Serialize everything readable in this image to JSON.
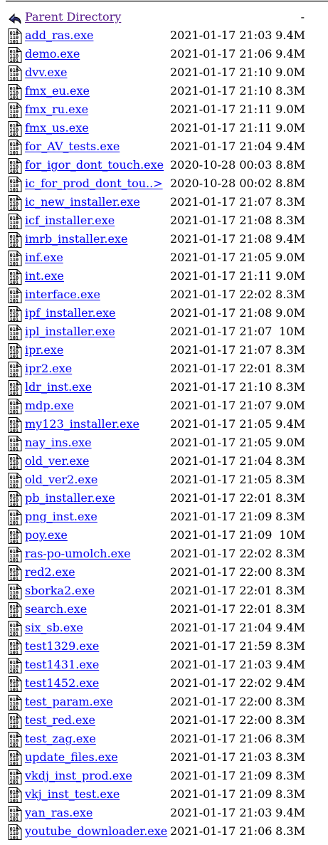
{
  "parent": {
    "label": "Parent Directory",
    "size": "-",
    "icon": "back-arrow-icon"
  },
  "file_icon": "binary-file-icon",
  "files": [
    {
      "name": "add_ras.exe",
      "date": "2021-01-17 21:03",
      "size": "9.4M"
    },
    {
      "name": "demo.exe",
      "date": "2021-01-17 21:06",
      "size": "9.4M"
    },
    {
      "name": "dvv.exe",
      "date": "2021-01-17 21:10",
      "size": "9.0M"
    },
    {
      "name": "fmx_eu.exe",
      "date": "2021-01-17 21:10",
      "size": "8.3M"
    },
    {
      "name": "fmx_ru.exe",
      "date": "2021-01-17 21:11",
      "size": "9.0M"
    },
    {
      "name": "fmx_us.exe",
      "date": "2021-01-17 21:11",
      "size": "9.0M"
    },
    {
      "name": "for_AV_tests.exe",
      "date": "2021-01-17 21:04",
      "size": "9.4M"
    },
    {
      "name": "for_igor_dont_touch.exe",
      "date": "2020-10-28 00:03",
      "size": "8.8M"
    },
    {
      "name": "ic_for_prod_dont_tou..>",
      "date": "2020-10-28 00:02",
      "size": "8.8M"
    },
    {
      "name": "ic_new_installer.exe",
      "date": "2021-01-17 21:07",
      "size": "8.3M"
    },
    {
      "name": "icf_installer.exe",
      "date": "2021-01-17 21:08",
      "size": "8.3M"
    },
    {
      "name": "imrb_installer.exe",
      "date": "2021-01-17 21:08",
      "size": "9.4M"
    },
    {
      "name": "inf.exe",
      "date": "2021-01-17 21:05",
      "size": "9.0M"
    },
    {
      "name": "int.exe",
      "date": "2021-01-17 21:11",
      "size": "9.0M"
    },
    {
      "name": "interface.exe",
      "date": "2021-01-17 22:02",
      "size": "8.3M"
    },
    {
      "name": "ipf_installer.exe",
      "date": "2021-01-17 21:08",
      "size": "9.0M"
    },
    {
      "name": "ipl_installer.exe",
      "date": "2021-01-17 21:07",
      "size": "10M"
    },
    {
      "name": "ipr.exe",
      "date": "2021-01-17 21:07",
      "size": "8.3M"
    },
    {
      "name": "ipr2.exe",
      "date": "2021-01-17 22:01",
      "size": "8.3M"
    },
    {
      "name": "ldr_inst.exe",
      "date": "2021-01-17 21:10",
      "size": "8.3M"
    },
    {
      "name": "mdp.exe",
      "date": "2021-01-17 21:07",
      "size": "9.0M"
    },
    {
      "name": "my123_installer.exe",
      "date": "2021-01-17 21:05",
      "size": "9.4M"
    },
    {
      "name": "nay_ins.exe",
      "date": "2021-01-17 21:05",
      "size": "9.0M"
    },
    {
      "name": "old_ver.exe",
      "date": "2021-01-17 21:04",
      "size": "8.3M"
    },
    {
      "name": "old_ver2.exe",
      "date": "2021-01-17 21:05",
      "size": "8.3M"
    },
    {
      "name": "pb_installer.exe",
      "date": "2021-01-17 22:01",
      "size": "8.3M"
    },
    {
      "name": "png_inst.exe",
      "date": "2021-01-17 21:09",
      "size": "8.3M"
    },
    {
      "name": "poy.exe",
      "date": "2021-01-17 21:09",
      "size": "10M"
    },
    {
      "name": "ras-po-umolch.exe",
      "date": "2021-01-17 22:02",
      "size": "8.3M"
    },
    {
      "name": "red2.exe",
      "date": "2021-01-17 22:00",
      "size": "8.3M"
    },
    {
      "name": "sborka2.exe",
      "date": "2021-01-17 22:01",
      "size": "8.3M"
    },
    {
      "name": "search.exe",
      "date": "2021-01-17 22:01",
      "size": "8.3M"
    },
    {
      "name": "six_sb.exe",
      "date": "2021-01-17 21:04",
      "size": "9.4M"
    },
    {
      "name": "test1329.exe",
      "date": "2021-01-17 21:59",
      "size": "8.3M"
    },
    {
      "name": "test1431.exe",
      "date": "2021-01-17 21:03",
      "size": "9.4M"
    },
    {
      "name": "test1452.exe",
      "date": "2021-01-17 22:02",
      "size": "9.4M"
    },
    {
      "name": "test_param.exe",
      "date": "2021-01-17 22:00",
      "size": "8.3M"
    },
    {
      "name": "test_red.exe",
      "date": "2021-01-17 22:00",
      "size": "8.3M"
    },
    {
      "name": "test_zag.exe",
      "date": "2021-01-17 21:06",
      "size": "8.3M"
    },
    {
      "name": "update_files.exe",
      "date": "2021-01-17 21:03",
      "size": "8.3M"
    },
    {
      "name": "vkdj_inst_prod.exe",
      "date": "2021-01-17 21:09",
      "size": "8.3M"
    },
    {
      "name": "vkj_inst_test.exe",
      "date": "2021-01-17 21:09",
      "size": "8.3M"
    },
    {
      "name": "yan_ras.exe",
      "date": "2021-01-17 21:03",
      "size": "9.4M"
    },
    {
      "name": "youtube_downloader.exe",
      "date": "2021-01-17 21:06",
      "size": "8.3M"
    }
  ]
}
